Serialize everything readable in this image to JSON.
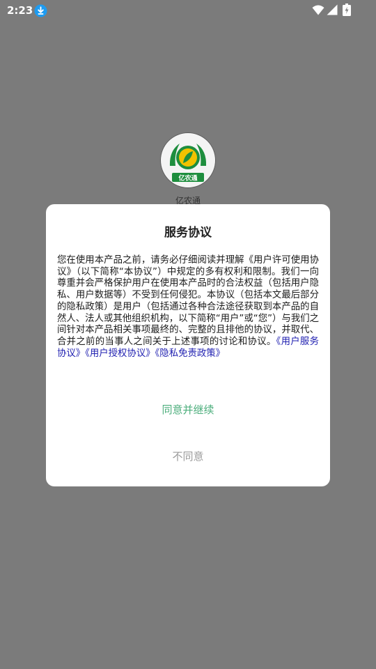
{
  "status_bar": {
    "time": "2:23",
    "icons": [
      "download-icon",
      "wifi-icon",
      "cell-signal-icon",
      "battery-charging-icon"
    ],
    "download_badge_color": "#1e9bf0"
  },
  "background": {
    "app_name": "亿农通",
    "logo_text": "亿农通",
    "logo_colors": {
      "green": "#1e8e3e",
      "yellow": "#f2c200"
    },
    "overlay_color": "#7b7b7b"
  },
  "dialog": {
    "title": "服务协议",
    "body_text": "您在使用本产品之前，请务必仔细阅读并理解《用户许可使用协议》（以下简称“本协议”）中规定的多有权利和限制。我们一向尊重并会严格保护用户在使用本产品时的合法权益（包括用户隐私、用户数据等）不受到任何侵犯。本协议（包括本文最后部分的隐私政策）是用户（包括通过各种合法途径获取到本产品的自然人、法人或其他组织机构，以下简称“用户”或“您”）与我们之间针对本产品相关事项最终的、完整的且排他的协议，并取代、合并之前的当事人之间关于上述事项的讨论和协议。",
    "links": {
      "service_agreement": "《用户服务协议》",
      "authorization_agreement": "《用户授权协议》",
      "privacy_policy": "《隐私免责政策》"
    },
    "agree_label": "同意并继续",
    "disagree_label": "不同意",
    "colors": {
      "link": "#1f1fb0",
      "agree": "#4cae7c",
      "disagree": "#9a9a9a"
    }
  }
}
